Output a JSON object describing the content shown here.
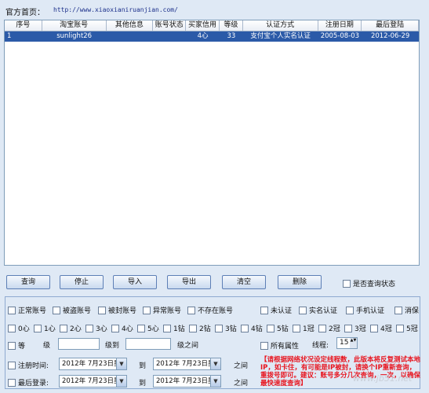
{
  "official_label": "官方首页：",
  "official_url": "http://www.xiaoxianiruanjian.com/",
  "table": {
    "columns": [
      "序号",
      "淘宝账号",
      "其他信息",
      "账号状态",
      "买家信用",
      "等级",
      "认证方式",
      "注册日期",
      "最后登陆"
    ],
    "rows": [
      [
        "1",
        "sunlight26",
        "",
        "",
        "4心",
        "33",
        "支付宝个人实名认证",
        "2005-08-03",
        "2012-06-29"
      ]
    ]
  },
  "buttons": {
    "query": "查询",
    "stop": "停止",
    "import": "导入",
    "export": "导出",
    "clear": "清空",
    "delete": "删除",
    "check_status": "是否查询状态"
  },
  "filters": {
    "row1": [
      "正常账号",
      "被盗账号",
      "被封账号",
      "异常账号",
      "不存在账号"
    ],
    "row1_right": [
      "未认证",
      "实名认证",
      "手机认证",
      "消保"
    ],
    "row2": [
      "0心",
      "1心",
      "2心",
      "3心",
      "4心",
      "5心",
      "1钻",
      "2钻",
      "3钻",
      "4钻",
      "5钻",
      "1冠",
      "2冠",
      "3冠",
      "4冠",
      "5冠"
    ],
    "level_label": "等",
    "level_unit": "级",
    "level_to": "级到",
    "level_between": "级之间",
    "all_attrs": "所有属性",
    "threads_label": "线程:",
    "threads_value": "15",
    "reg_time": "注册时间:",
    "last_login": "最后登录:",
    "date_from": "2012年 7月23日星",
    "date_to": "2012年 7月23日星",
    "to": "到",
    "between": "之间",
    "dropdown_arrow": "▼",
    "spin_arrows": "▲▼"
  },
  "notice": "【请根据网络状况设定线程数，此版本将反复测试本地IP，如卡住，有可能是IP被封，请换个IP重新查询，重拨号即可。建议：账号多分几次查询，一次，以确保最快速度查询】",
  "watermark": "www.jb51.net"
}
